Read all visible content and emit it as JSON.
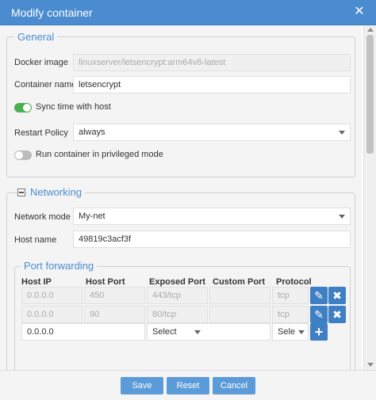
{
  "dialog": {
    "title": "Modify container",
    "close_icon": "close-icon"
  },
  "general": {
    "legend": "General",
    "docker_image_label": "Docker image",
    "docker_image_value": "linuxserver/letsencrypt:arm64v8-latest",
    "container_name_label": "Container name",
    "container_name_value": "letsencrypt",
    "sync_time_label": "Sync time with host",
    "sync_time_on": true,
    "restart_policy_label": "Restart Policy",
    "restart_policy_value": "always",
    "privileged_label": "Run container in privileged mode",
    "privileged_on": false
  },
  "networking": {
    "legend": "Networking",
    "network_mode_label": "Network mode",
    "network_mode_value": "My-net",
    "host_name_label": "Host name",
    "host_name_value": "49819c3acf3f"
  },
  "port_forwarding": {
    "legend": "Port forwarding",
    "headers": [
      "Host IP",
      "Host Port",
      "Exposed Port",
      "Custom Port",
      "Protocol"
    ],
    "rows": [
      {
        "host_ip": "0.0.0.0",
        "host_port": "450",
        "exposed_port": "443/tcp",
        "custom_port": "",
        "protocol": "tcp"
      },
      {
        "host_ip": "0.0.0.0",
        "host_port": "90",
        "exposed_port": "80/tcp",
        "custom_port": "",
        "protocol": "tcp"
      }
    ],
    "new_row": {
      "host_ip": "0.0.0.0",
      "host_port": "",
      "exposed_port": "Select",
      "protocol": "Sele"
    },
    "edit_icon_glyph": "✎",
    "delete_icon_glyph": "✖",
    "add_icon_glyph": "+"
  },
  "footer": {
    "save": "Save",
    "reset": "Reset",
    "cancel": "Cancel"
  },
  "colors": {
    "accent": "#4a8ccf",
    "button": "#5b9bd8",
    "toggle_on": "#4caf50"
  }
}
